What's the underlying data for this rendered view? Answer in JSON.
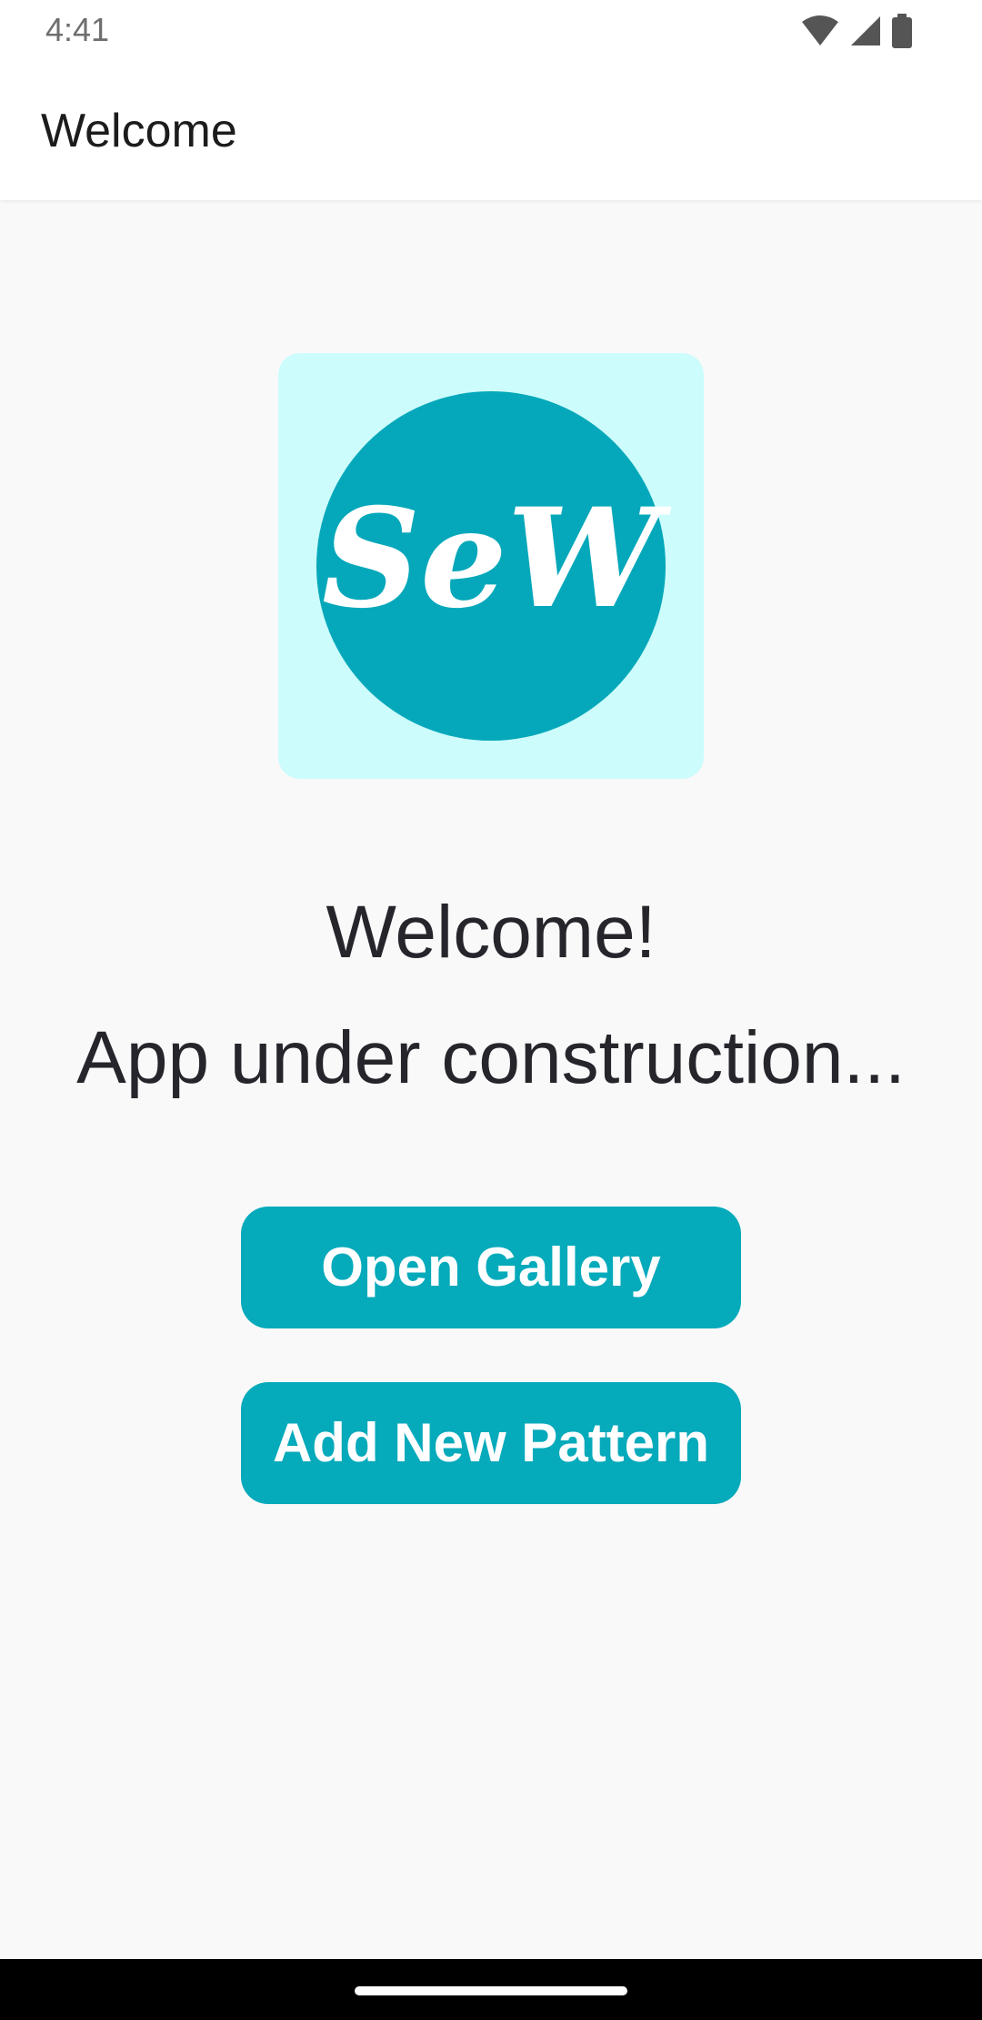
{
  "status_bar": {
    "time": "4:41",
    "icons": [
      "wifi-icon",
      "cellular-signal-icon",
      "battery-icon"
    ]
  },
  "app_bar": {
    "title": "Welcome"
  },
  "logo": {
    "text": "SeW",
    "circle_color": "#05a8ba",
    "tile_color": "#ccfcfc"
  },
  "main": {
    "title": "Welcome!",
    "subtitle": "App under construction..."
  },
  "buttons": {
    "open_gallery": "Open Gallery",
    "add_new_pattern": "Add New Pattern"
  },
  "colors": {
    "accent": "#05aabb",
    "text": "#25252b",
    "background": "#f9f9f9"
  }
}
